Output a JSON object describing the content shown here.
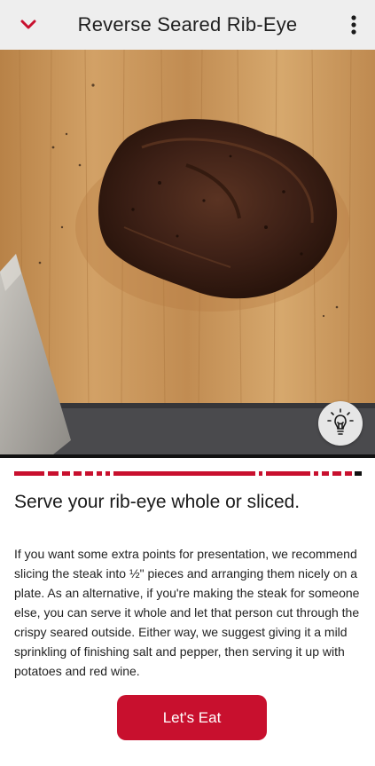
{
  "header": {
    "title": "Reverse Seared Rib-Eye",
    "back_icon": "chevron-down-icon",
    "menu_icon": "more-vertical-icon"
  },
  "hero": {
    "description_icon": "lightbulb-icon"
  },
  "progress": {
    "active_color": "#c8102e",
    "inactive_color": "#111111"
  },
  "step": {
    "heading": "Serve your rib-eye whole or sliced.",
    "body": "If you want some extra points for presentation, we recommend slicing the steak into ½\" pieces and arranging them nicely on a plate. As an alternative, if you're making the steak for someone else, you can serve it whole and let that person cut through the crispy seared outside. Either way, we suggest giving it a mild sprinkling of finishing salt and pepper, then serving it up with potatoes and red wine."
  },
  "cta": {
    "label": "Let's Eat"
  },
  "colors": {
    "accent": "#c8102e",
    "header_bg": "#eeeeee"
  }
}
